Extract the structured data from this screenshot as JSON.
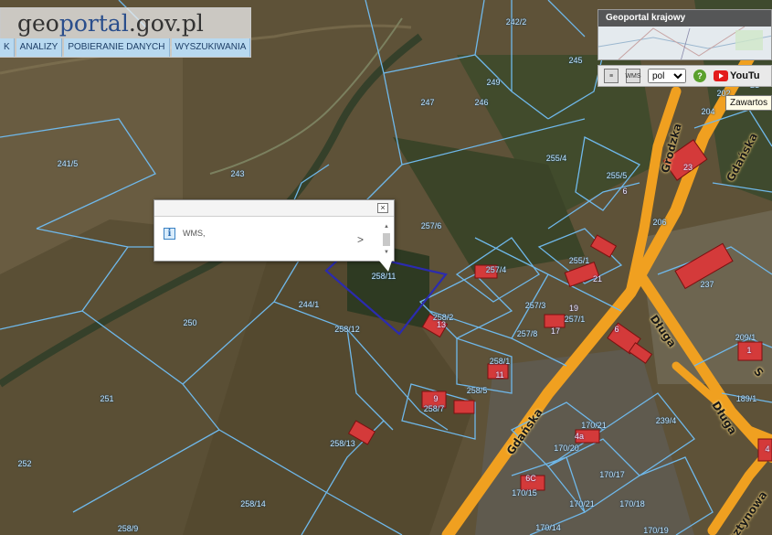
{
  "header": {
    "logo_part1": "geo",
    "logo_part2": "portal",
    "logo_part3": ".gov.pl",
    "menu": [
      "K",
      "ANALIZY",
      "POBIERANIE DANYCH",
      "WYSZUKIWANIA"
    ]
  },
  "minimap": {
    "title": "Geoportal krajowy"
  },
  "toolbar": {
    "language": "pol",
    "language_options": [
      "pol"
    ],
    "help": "?",
    "youtube_text": "YouTu",
    "wms_label": "WMS"
  },
  "tooltip": "Zawartos",
  "popup": {
    "text": "WMS,",
    "chevron": ">",
    "close": "×"
  },
  "parcels": [
    {
      "id": "p241_5",
      "label": "241/5"
    },
    {
      "id": "p242_2",
      "label": "242/2"
    },
    {
      "id": "p245",
      "label": "245"
    },
    {
      "id": "p243",
      "label": "243"
    },
    {
      "id": "p249",
      "label": "249"
    },
    {
      "id": "p247",
      "label": "247"
    },
    {
      "id": "p246",
      "label": "246"
    },
    {
      "id": "p255_4",
      "label": "255/4"
    },
    {
      "id": "p255_5",
      "label": "255/5"
    },
    {
      "id": "p257_6",
      "label": "257/6"
    },
    {
      "id": "p257_4",
      "label": "257/4"
    },
    {
      "id": "p258_11",
      "label": "258/11"
    },
    {
      "id": "p255_1",
      "label": "255/1"
    },
    {
      "id": "p244_1",
      "label": "244/1"
    },
    {
      "id": "p258_2",
      "label": "258/2"
    },
    {
      "id": "p250",
      "label": "250"
    },
    {
      "id": "p258_12",
      "label": "258/12"
    },
    {
      "id": "p257_3",
      "label": "257/3"
    },
    {
      "id": "p257_1",
      "label": "257/1"
    },
    {
      "id": "p257_8",
      "label": "257/8"
    },
    {
      "id": "p258_1",
      "label": "258/1"
    },
    {
      "id": "p251",
      "label": "251"
    },
    {
      "id": "p258_5",
      "label": "258/5"
    },
    {
      "id": "p258_7",
      "label": "258/7"
    },
    {
      "id": "p252",
      "label": "252"
    },
    {
      "id": "p258_13",
      "label": "258/13"
    },
    {
      "id": "p258_14",
      "label": "258/14"
    },
    {
      "id": "p258_9",
      "label": "258/9"
    },
    {
      "id": "p206",
      "label": "206"
    },
    {
      "id": "p204",
      "label": "204"
    },
    {
      "id": "p237",
      "label": "237"
    },
    {
      "id": "p209_1",
      "label": "209/1"
    },
    {
      "id": "p189_1",
      "label": "189/1"
    },
    {
      "id": "p239_4",
      "label": "239/4"
    },
    {
      "id": "p170_21a",
      "label": "170/21"
    },
    {
      "id": "p170_20",
      "label": "170/20"
    },
    {
      "id": "p170_17",
      "label": "170/17"
    },
    {
      "id": "p170_15",
      "label": "170/15"
    },
    {
      "id": "p170_21b",
      "label": "170/21"
    },
    {
      "id": "p170_18",
      "label": "170/18"
    },
    {
      "id": "p170_14",
      "label": "170/14"
    },
    {
      "id": "p170_19",
      "label": "170/19"
    },
    {
      "id": "p21",
      "label": "21"
    },
    {
      "id": "p202",
      "label": "202"
    }
  ],
  "buildings": [
    {
      "id": "b23",
      "label": "23"
    },
    {
      "id": "b6a",
      "label": "6"
    },
    {
      "id": "b21",
      "label": "21"
    },
    {
      "id": "b19",
      "label": "19"
    },
    {
      "id": "b17",
      "label": "17"
    },
    {
      "id": "b13",
      "label": "13"
    },
    {
      "id": "b11",
      "label": "11"
    },
    {
      "id": "b9",
      "label": "9"
    },
    {
      "id": "b6b",
      "label": "6"
    },
    {
      "id": "b1",
      "label": "1"
    },
    {
      "id": "b4a",
      "label": "4a"
    },
    {
      "id": "b6c",
      "label": "6C"
    },
    {
      "id": "b4",
      "label": "4"
    }
  ],
  "streets": [
    {
      "id": "grodzka",
      "label": "Grodzka"
    },
    {
      "id": "gdanska1",
      "label": "Gdańska"
    },
    {
      "id": "dluga1",
      "label": "Długa"
    },
    {
      "id": "gdanska2",
      "label": "Gdańska"
    },
    {
      "id": "dluga2",
      "label": "Długa"
    },
    {
      "id": "sosnowa",
      "label": "rsztynowa"
    },
    {
      "id": "edge_s",
      "label": "S"
    }
  ],
  "colors": {
    "road": "#f0a020",
    "parcel_line": "#6fb8ea",
    "selection": "#2b2bb0",
    "building": "#d43a3a"
  }
}
